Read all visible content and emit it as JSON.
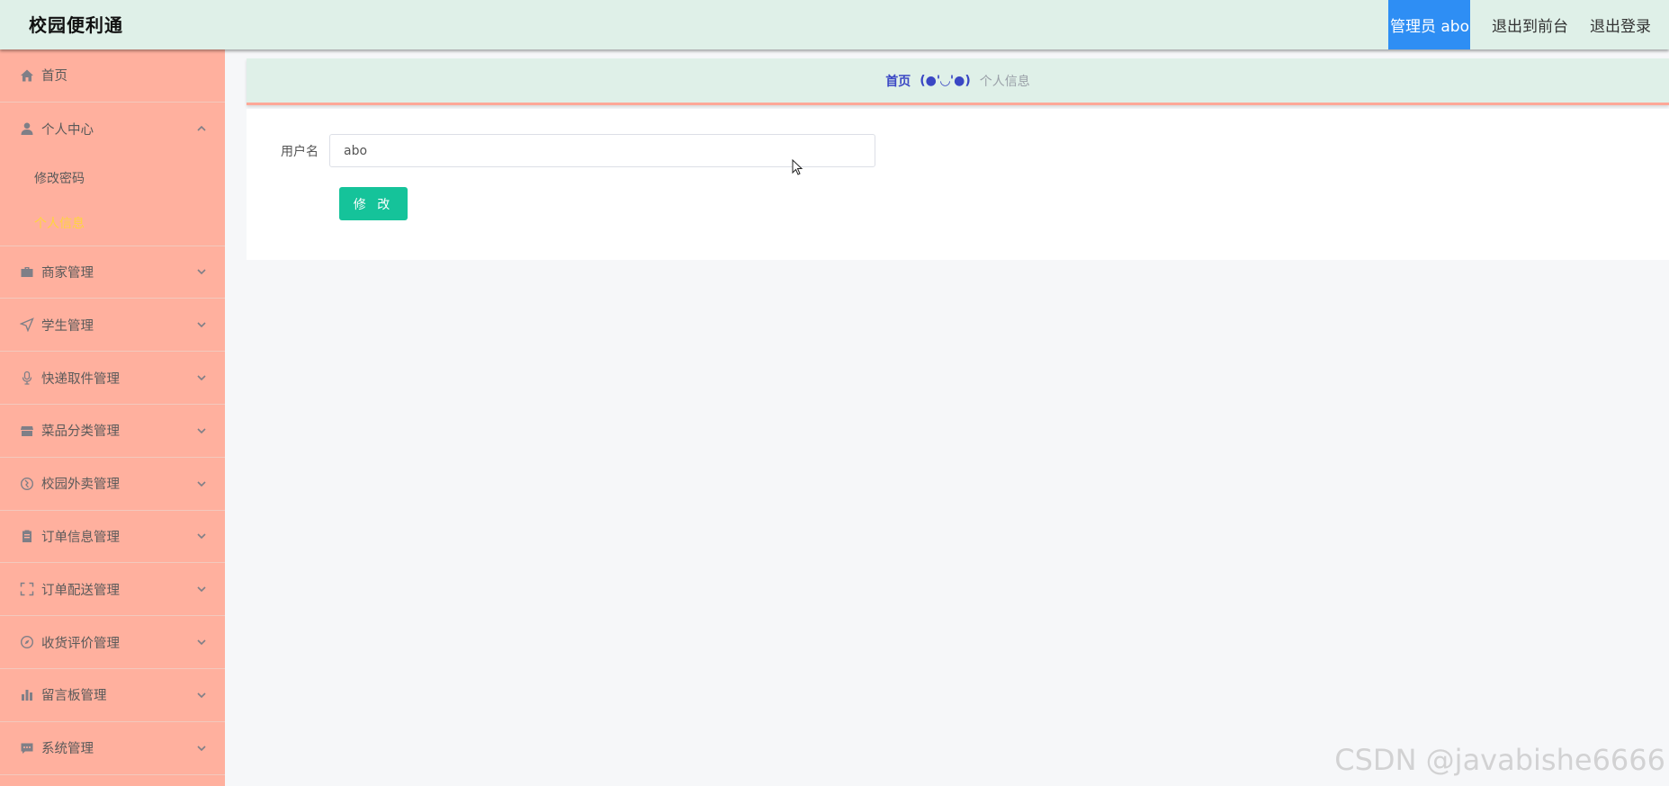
{
  "header": {
    "app_title": "校园便利通",
    "admin_label": "管理员 abo",
    "links": [
      "退出到前台",
      "退出登录"
    ]
  },
  "sidebar": {
    "items": [
      {
        "label": "首页",
        "icon": "home-icon",
        "expandable": false
      },
      {
        "label": "个人中心",
        "icon": "user-icon",
        "expandable": true,
        "expanded": true,
        "children": [
          {
            "label": "修改密码",
            "active": false
          },
          {
            "label": "个人信息",
            "active": true
          }
        ]
      },
      {
        "label": "商家管理",
        "icon": "briefcase-icon",
        "expandable": true
      },
      {
        "label": "学生管理",
        "icon": "send-icon",
        "expandable": true
      },
      {
        "label": "快递取件管理",
        "icon": "microphone-icon",
        "expandable": true
      },
      {
        "label": "菜品分类管理",
        "icon": "shop-icon",
        "expandable": true
      },
      {
        "label": "校园外卖管理",
        "icon": "globe-icon",
        "expandable": true
      },
      {
        "label": "订单信息管理",
        "icon": "clipboard-icon",
        "expandable": true
      },
      {
        "label": "订单配送管理",
        "icon": "fullscreen-icon",
        "expandable": true
      },
      {
        "label": "收货评价管理",
        "icon": "compass-icon",
        "expandable": true
      },
      {
        "label": "留言板管理",
        "icon": "bar-chart-icon",
        "expandable": true
      },
      {
        "label": "系统管理",
        "icon": "message-icon",
        "expandable": true
      }
    ]
  },
  "breadcrumb": {
    "home": "首页",
    "separator": "(●'◡'●)",
    "current": "个人信息"
  },
  "form": {
    "username_label": "用户名",
    "username_value": "abo",
    "submit_label": "修 改"
  },
  "watermark": "CSDN @javabishe6666",
  "colors": {
    "topbar": "#dff0e8",
    "sidebar": "#ffb09e",
    "admin_badge": "#2e8ef4",
    "active_sub": "#ffd53d",
    "button": "#15c39a",
    "breadcrumb_home": "#3a47c4"
  }
}
